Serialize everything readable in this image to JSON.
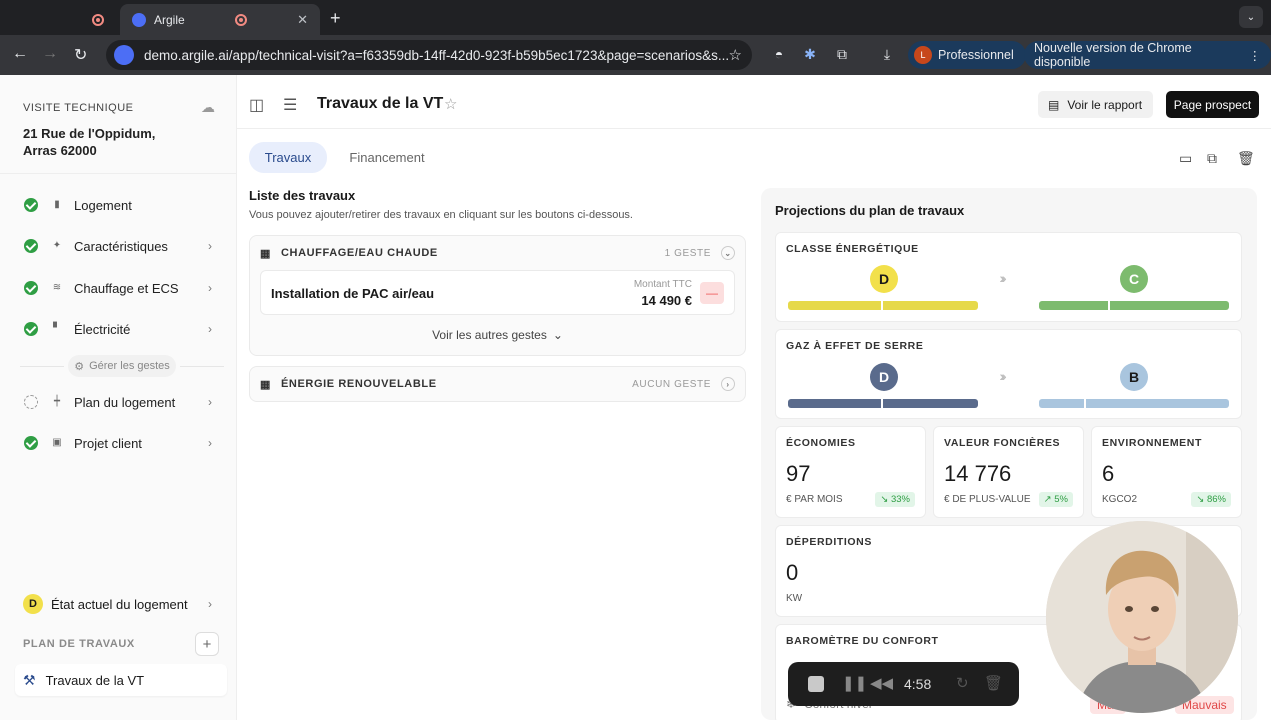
{
  "browser": {
    "tab_title": "Argile",
    "url": "demo.argile.ai/app/technical-visit?a=f63359db-14ff-42d0-923f-b59b5ec1723&page=scenarios&s...",
    "profile_initial": "L",
    "profile_label": "Professionnel",
    "update_label": "Nouvelle version de Chrome disponible"
  },
  "sidebar": {
    "header": "VISITE TECHNIQUE",
    "address_line1": "21 Rue de l'Oppidum,",
    "address_line2": "Arras 62000",
    "items": [
      {
        "label": "Logement",
        "status": "done"
      },
      {
        "label": "Caractéristiques",
        "status": "done"
      },
      {
        "label": "Chauffage et ECS",
        "status": "done"
      },
      {
        "label": "Électricité",
        "status": "done"
      },
      {
        "label": "Plan du logement",
        "status": "pending"
      },
      {
        "label": "Projet client",
        "status": "done"
      }
    ],
    "manage_label": "Gérer les gestes",
    "current_class": "D",
    "current_label": "État actuel du logement",
    "plan_header": "PLAN DE TRAVAUX",
    "plan_item": "Travaux de la VT"
  },
  "header": {
    "title": "Travaux de la VT",
    "report_button": "Voir le rapport",
    "prospect_button": "Page prospect"
  },
  "tabs": [
    {
      "label": "Travaux",
      "active": true
    },
    {
      "label": "Financement",
      "active": false
    }
  ],
  "works": {
    "title": "Liste des travaux",
    "subtitle": "Vous pouvez ajouter/retirer des travaux en cliquant sur les boutons ci-dessous.",
    "categories": [
      {
        "name": "CHAUFFAGE/EAU CHAUDE",
        "count": "1 GESTE",
        "items": [
          {
            "label": "Installation de PAC air/eau",
            "amount_label": "Montant TTC",
            "amount": "14 490 €"
          }
        ],
        "more_label": "Voir les autres gestes"
      },
      {
        "name": "ÉNERGIE RENOUVELABLE",
        "count": "AUCUN GESTE"
      }
    ]
  },
  "projections": {
    "title": "Projections du plan de travaux",
    "energy": {
      "label": "CLASSE ÉNERGÉTIQUE",
      "from": "D",
      "to": "C",
      "from_color": "#f2e04b",
      "to_color": "#7dbb6e"
    },
    "ghg": {
      "label": "GAZ À EFFET DE SERRE",
      "from": "D",
      "to": "B",
      "from_color": "#5a6b8c",
      "to_color": "#a9c5de"
    },
    "stats": [
      {
        "label": "ÉCONOMIES",
        "value": "97",
        "unit": "€ PAR MOIS",
        "badge": "↘ 33%"
      },
      {
        "label": "VALEUR FONCIÈRES",
        "value": "14 776",
        "unit": "€ DE PLUS-VALUE",
        "badge": "↗ 5%"
      },
      {
        "label": "ENVIRONNEMENT",
        "value": "6",
        "unit": "KGCO2",
        "badge": "↘ 86%"
      }
    ],
    "losses": {
      "label": "DÉPERDITIONS",
      "value": "0",
      "unit": "KW"
    },
    "comfort": {
      "label": "BAROMÈTRE DU CONFORT",
      "row_label": "Confort hiver",
      "status_from": "Mauvais",
      "status_to": "Mauvais"
    }
  },
  "recorder": {
    "time": "4:58"
  }
}
